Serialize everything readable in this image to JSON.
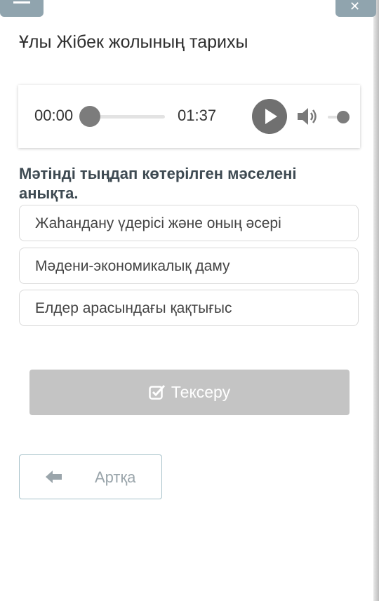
{
  "header": {
    "title": "Ұлы Жібек жолының тарихы"
  },
  "player": {
    "current_time": "00:00",
    "duration": "01:37",
    "progress": 0.0,
    "volume": 1.0
  },
  "question": {
    "prompt": "Мәтінді тыңдап көтерілген мәселені анықта."
  },
  "options": [
    {
      "label": "Жаһандану үдерісі және оның әсері"
    },
    {
      "label": "Мәдени-экономикалық даму"
    },
    {
      "label": "Елдер арасындағы қақтығыс"
    }
  ],
  "actions": {
    "check_label": "Тексеру",
    "back_label": "Артқа"
  },
  "colors": {
    "accent_grey": "#c4c4c4",
    "back_border": "#a7c2ca",
    "top_button": "#90a4ae"
  }
}
